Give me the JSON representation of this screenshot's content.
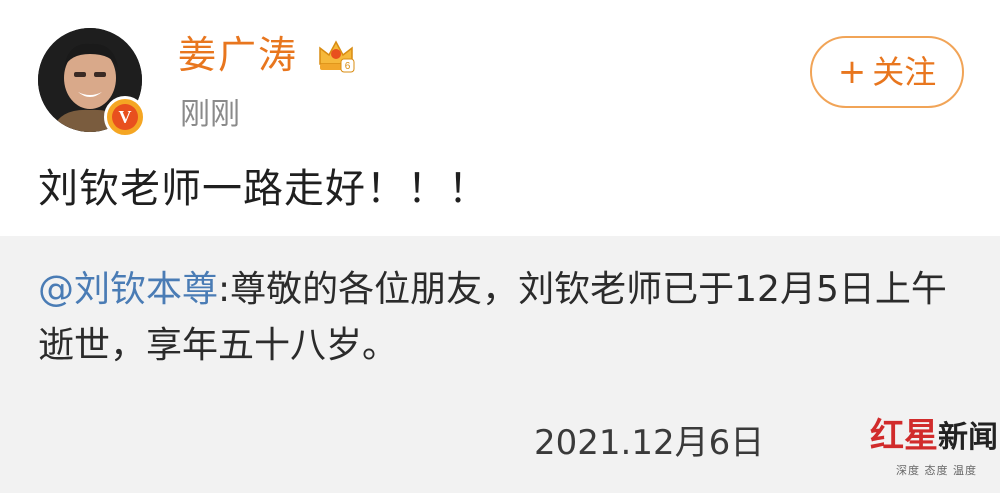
{
  "post": {
    "username": "姜广涛",
    "time": "刚刚",
    "follow_label": "关注",
    "follow_symbol": "+",
    "text": "刘钦老师一路走好！！！",
    "verified_mark": "V",
    "crown_badge_number": "6"
  },
  "repost": {
    "mention": "@刘钦本尊",
    "body": ":尊敬的各位朋友，刘钦老师已于12月5日上午逝世，享年五十八岁。",
    "date": "2021.12月6日"
  },
  "watermark": {
    "title_red": "红星",
    "title_dark": "新闻",
    "subtitle": "深度 态度 温度"
  },
  "colors": {
    "username": "#e8761e",
    "follow_border": "#f1a457",
    "mention": "#4a7cb5",
    "repost_bg": "#f2f2f2",
    "verified_badge": "#f5a623",
    "watermark_red": "#d12b2b"
  },
  "icons": {
    "avatar": "user-avatar",
    "verified": "verified-v-icon",
    "crown": "crown-level-icon",
    "follow_plus": "plus-icon"
  }
}
